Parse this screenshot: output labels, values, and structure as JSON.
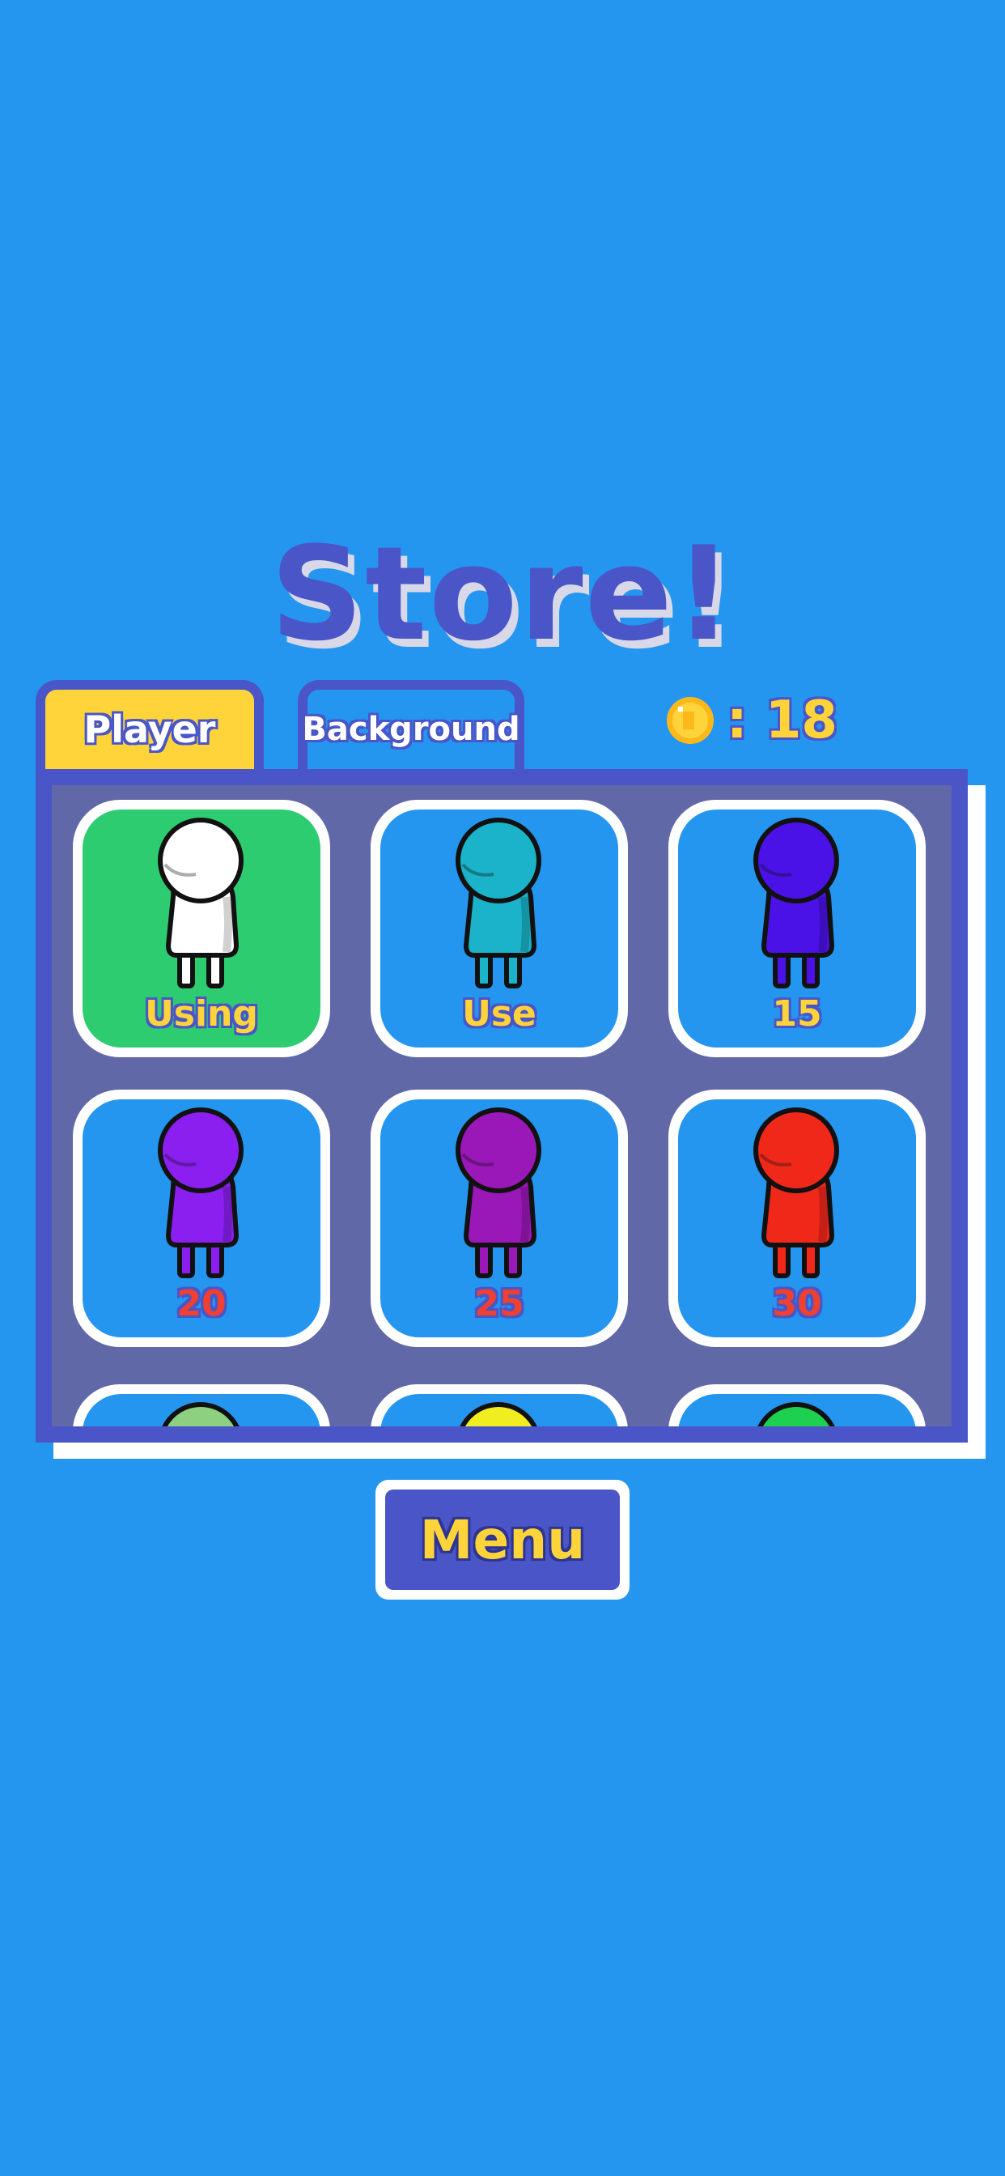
{
  "title": "Store!",
  "tabs": [
    {
      "label": "Player",
      "active": true
    },
    {
      "label": "Background",
      "active": false
    }
  ],
  "coins": {
    "icon": "coin-icon",
    "text": ": 18"
  },
  "colors": {
    "background": "#2596f0",
    "accent_blue": "#4a56c8",
    "accent_yellow": "#ffd43b",
    "using_green": "#2ecc71",
    "price_red": "#f04030"
  },
  "items": [
    {
      "color": "#ffffff",
      "label": "Using",
      "label_style": "yellow",
      "state": "using"
    },
    {
      "color": "#1ab3c9",
      "label": "Use",
      "label_style": "yellow",
      "state": "owned"
    },
    {
      "color": "#4a12e6",
      "label": "15",
      "label_style": "yellow",
      "state": "buy"
    },
    {
      "color": "#8a1ff0",
      "label": "20",
      "label_style": "red",
      "state": "locked"
    },
    {
      "color": "#9a18b8",
      "label": "25",
      "label_style": "red",
      "state": "locked"
    },
    {
      "color": "#f0281a",
      "label": "30",
      "label_style": "red",
      "state": "locked"
    },
    {
      "color": "#8cd080",
      "label": "",
      "label_style": "red",
      "state": "locked"
    },
    {
      "color": "#f0ee20",
      "label": "",
      "label_style": "red",
      "state": "locked"
    },
    {
      "color": "#1ed050",
      "label": "",
      "label_style": "red",
      "state": "locked"
    }
  ],
  "menu_button": {
    "label": "Menu"
  }
}
